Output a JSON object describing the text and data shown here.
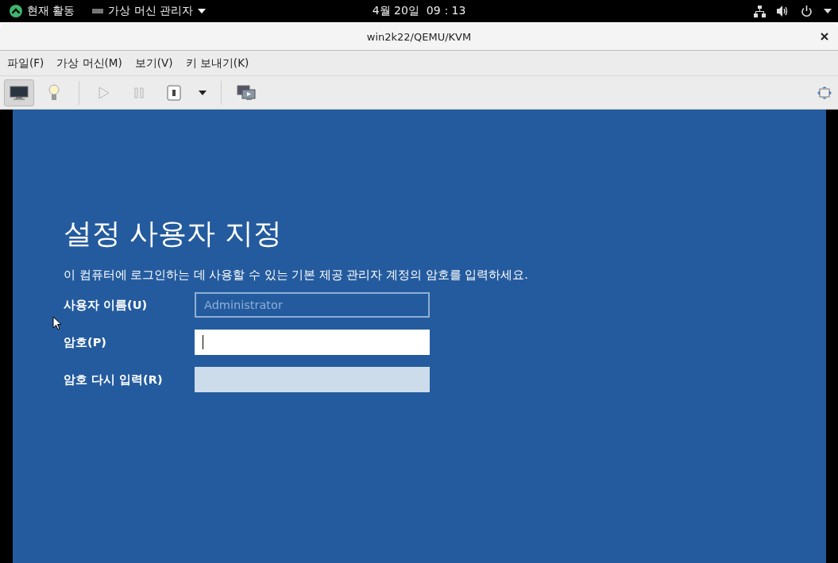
{
  "top_bar": {
    "activities": "현재 활동",
    "app_menu": "가상 머신 관리자",
    "clock": "4월 20일  09：13"
  },
  "window": {
    "title": "win2k22/QEMU/KVM"
  },
  "menu": [
    "파일(F)",
    "가상 머신(M)",
    "보기(V)",
    "키 보내기(K)"
  ],
  "toolbar": [
    {
      "kind": "console",
      "selected": true,
      "disabled": false
    },
    {
      "kind": "details",
      "selected": false,
      "disabled": false
    },
    {
      "kind": "separator"
    },
    {
      "kind": "run",
      "selected": false,
      "disabled": true
    },
    {
      "kind": "pause",
      "selected": false,
      "disabled": true
    },
    {
      "kind": "shutdown",
      "selected": false,
      "disabled": false
    },
    {
      "kind": "dropdown",
      "selected": false,
      "disabled": false
    },
    {
      "kind": "separator"
    },
    {
      "kind": "snapshots",
      "selected": false,
      "disabled": false
    }
  ],
  "guest": {
    "heading": "설정 사용자 지정",
    "description": "이 컴퓨터에 로그인하는 데 사용할 수 있는 기본 제공 관리자 계정의 암호를 입력하세요.",
    "fields": [
      {
        "label": "사용자 이름(U)",
        "value": "Administrator",
        "readonly": true,
        "focused": false,
        "disabled": false
      },
      {
        "label": "암호(P)",
        "readonly": false,
        "focused": true,
        "disabled": false
      },
      {
        "label": "암호 다시 입력(R)",
        "readonly": false,
        "focused": false,
        "disabled": true
      }
    ]
  }
}
